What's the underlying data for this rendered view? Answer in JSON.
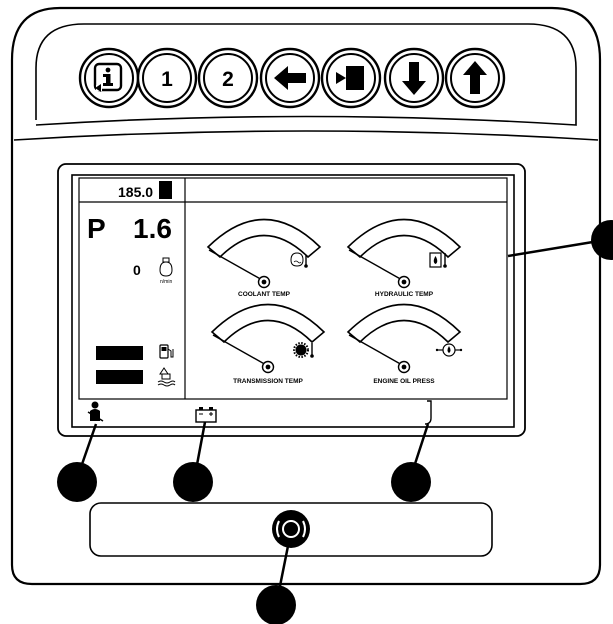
{
  "keypad": {
    "info_icon": "info-icon",
    "button_1": "1",
    "button_2": "2",
    "left_arrow_icon": "arrow-left-icon",
    "stop_icon": "stop-square-icon",
    "down_arrow_icon": "arrow-down-icon",
    "up_arrow_icon": "arrow-up-icon"
  },
  "display": {
    "hour_meter": "185.0",
    "gear": "P",
    "speed": "1.6",
    "rpm": "0",
    "rpm_unit": "n/min",
    "gauges": [
      {
        "label": "COOLANT TEMP",
        "icon": "coolant-temp-icon",
        "needle_level": 0.0
      },
      {
        "label": "HYDRAULIC TEMP",
        "icon": "hydraulic-temp-icon",
        "needle_level": 0.0
      },
      {
        "label": "TRANSMISSION TEMP",
        "icon": "transmission-temp-icon",
        "needle_level": 0.0
      },
      {
        "label": "ENGINE OIL PRESS",
        "icon": "oil-pressure-icon",
        "needle_level": 0.0
      }
    ],
    "fuel_icon": "fuel-pump-icon",
    "def_icon": "def-fluid-icon",
    "seat_belt_icon": "seat-belt-icon",
    "battery_icon": "battery-icon",
    "park_brake_icon": "park-brake-lever-icon"
  },
  "lower_panel": {
    "brake_icon": "brake-indicator-icon"
  }
}
